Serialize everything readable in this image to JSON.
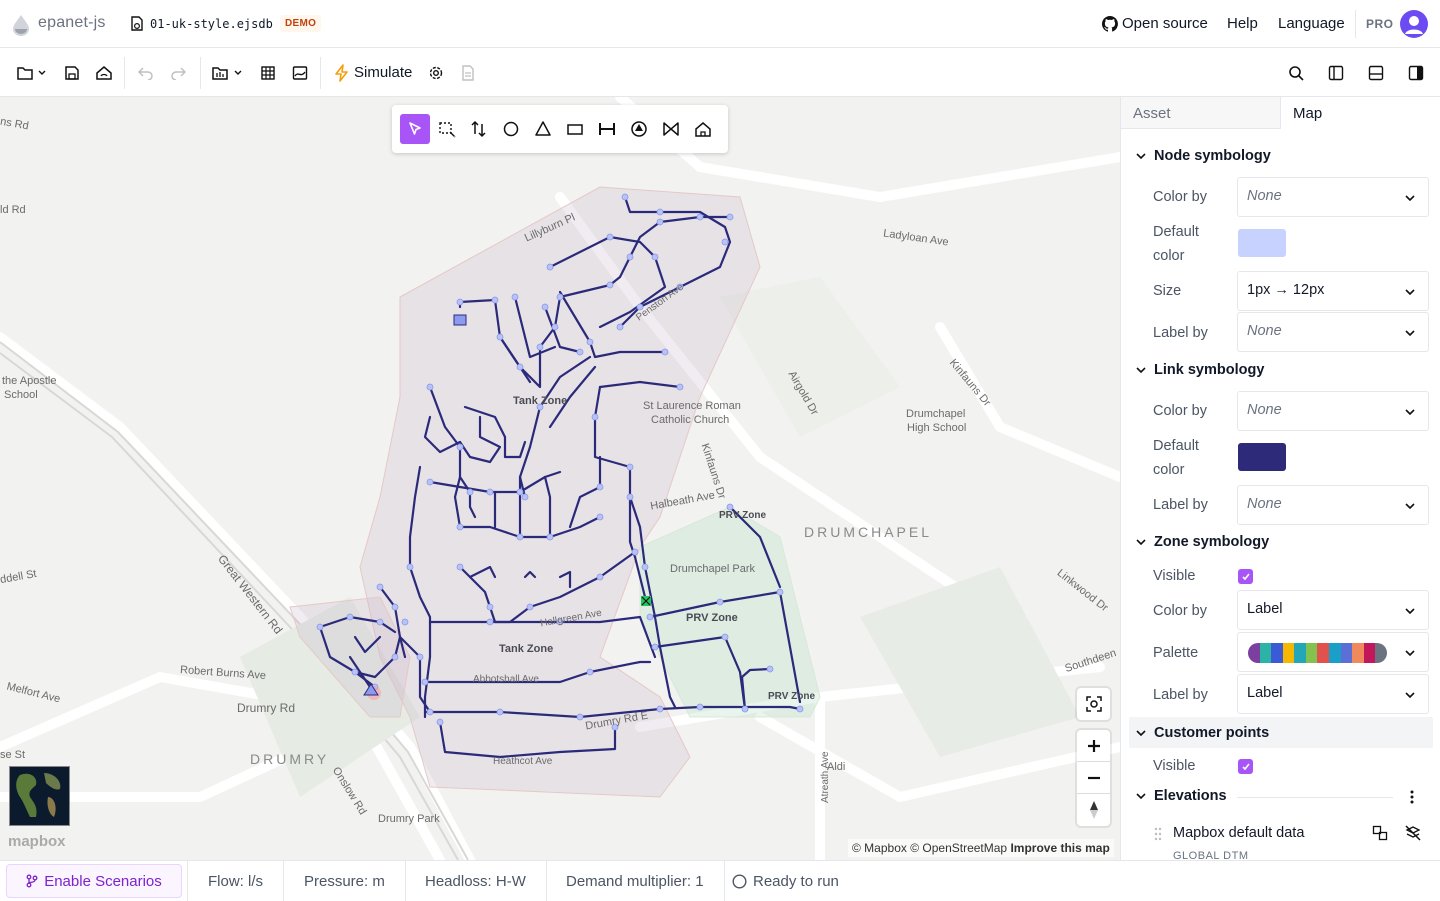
{
  "header": {
    "brand": "epanet-js",
    "filename": "01-uk-style.ejsdb",
    "badge": "DEMO",
    "nav": {
      "open_source": "Open source",
      "help": "Help",
      "language": "Language"
    },
    "plan": "PRO"
  },
  "toolbar": {
    "simulate_label": "Simulate",
    "icons": [
      "folder-icon",
      "save-icon",
      "save-cloud-icon",
      "undo-icon",
      "redo-icon",
      "import-icon",
      "table-icon",
      "scenario-icon",
      "simulate-icon",
      "settings-icon",
      "report-icon",
      "search-icon",
      "sidebar-left-icon",
      "bottom-panel-icon",
      "sidebar-right-icon"
    ]
  },
  "draw_tools": [
    "select",
    "select-area",
    "reshape",
    "junction",
    "reservoir",
    "tank",
    "pipe",
    "pump",
    "valve",
    "customer-point"
  ],
  "map": {
    "street_labels": {
      "ns_rd": "ns Rd",
      "ld_rd": "ld Rd",
      "apostle_1": "the Apostle",
      "apostle_2": "School",
      "ddell_st": "ddell St",
      "robert_burns": "Robert Burns Ave",
      "melfort": "Melfort Ave",
      "drumry_rd": "Drumry Rd",
      "se_st": "se St",
      "drumry": "DRUMRY",
      "onslow": "Onslow Rd",
      "drumry_park": "Drumry Park",
      "great_western": "Great Western Rd",
      "lillyburn": "Lillyburn Pl",
      "ladyloan": "Ladyloan Ave",
      "airgold": "Airgold Dr",
      "kinfauns_dr": "Kinfauns Dr",
      "kinfauns_dr2": "Kinfauns Dr",
      "drumchapel_hs_1": "Drumchapel",
      "drumchapel_hs_2": "High School",
      "st_laurence_1": "St Laurence Roman",
      "st_laurence_2": "Catholic Church",
      "halbeath": "Halbeath Ave",
      "drumchapel": "DRUMCHAPEL",
      "drumchapel_park": "Drumchapel Park",
      "linkwood": "Linkwood Dr",
      "southdeen": "Southdeen",
      "aldi": "Aldi",
      "heathcot": "Heathcot Ave",
      "abbotshall": "Abbotshall Ave",
      "hallgreen": "Hallgreen Ave",
      "drumry_rd_e": "Drumry Rd E",
      "penston": "Penston Ave",
      "ayr": "Atreath Ave"
    },
    "zone_labels": {
      "tank_zone_1": "Tank Zone",
      "tank_zone_2": "Tank Zone",
      "prv_zone_1": "PRV Zone",
      "prv_zone_2": "PRV Zone",
      "prv_zone_3": "PRV Zone"
    },
    "attribution": {
      "mapbox": "© Mapbox",
      "osm": "© OpenStreetMap",
      "improve": "Improve this map"
    },
    "logo": "mapbox"
  },
  "panel": {
    "tabs": {
      "asset": "Asset",
      "map": "Map"
    },
    "node_symbology": {
      "title": "Node symbology",
      "color_by_label": "Color by",
      "color_by_value": "None",
      "default_color_label_1": "Default",
      "default_color_label_2": "color",
      "default_color": "#c7d2fe",
      "size_label": "Size",
      "size_value": "1px → 12px",
      "label_by_label": "Label by",
      "label_by_value": "None"
    },
    "link_symbology": {
      "title": "Link symbology",
      "color_by_label": "Color by",
      "color_by_value": "None",
      "default_color_label_1": "Default",
      "default_color_label_2": "color",
      "default_color": "#2e2a7a",
      "label_by_label": "Label by",
      "label_by_value": "None"
    },
    "zone_symbology": {
      "title": "Zone symbology",
      "visible_label": "Visible",
      "visible": true,
      "color_by_label": "Color by",
      "color_by_value": "Label",
      "palette_label": "Palette",
      "palette": [
        "#7b3fa0",
        "#2bb3a6",
        "#3b5bd6",
        "#f5b700",
        "#22a7b8",
        "#83c24e",
        "#e0524b",
        "#1aa0c8",
        "#5b6fd6",
        "#f08a5d",
        "#c2185b",
        "#6b7280"
      ],
      "label_by_label": "Label by",
      "label_by_value": "Label"
    },
    "customer_points": {
      "title": "Customer points",
      "visible_label": "Visible",
      "visible": true
    },
    "elevations": {
      "title": "Elevations",
      "source_name": "Mapbox default data",
      "source_sub": "GLOBAL DTM"
    }
  },
  "footer": {
    "enable_scenarios": "Enable Scenarios",
    "flow": "Flow: l/s",
    "pressure": "Pressure: m",
    "headloss": "Headloss: H-W",
    "demand": "Demand multiplier: 1",
    "status": "Ready to run"
  }
}
